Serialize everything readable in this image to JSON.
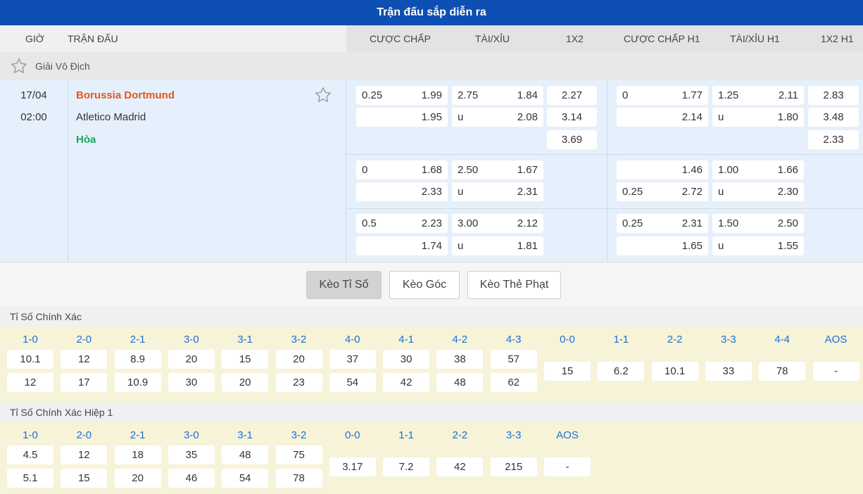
{
  "header": {
    "title": "Trận đấu sắp diễn ra"
  },
  "columns": {
    "time": "GIỜ",
    "match": "TRẬN ĐẤU",
    "handicap": "CƯỢC CHẤP",
    "overunder": "TÀI/XỈU",
    "x12": "1X2",
    "handicap_h1": "CƯỢC CHẤP H1",
    "overunder_h1": "TÀI/XỈU H1",
    "x12_h1": "1X2 H1"
  },
  "league": {
    "name": "Giải Vô Địch",
    "icon": "star-outline-icon"
  },
  "match": {
    "date": "17/04",
    "time": "02:00",
    "home": "Borussia Dortmund",
    "away": "Atletico Madrid",
    "draw": "Hòa",
    "colors": {
      "home": "#e3561f",
      "draw": "#17a85a"
    },
    "x12": [
      "2.27",
      "3.14",
      "3.69"
    ],
    "x12_h1": [
      "2.83",
      "3.48",
      "2.33"
    ],
    "lines": [
      {
        "hdp": {
          "line_top": "0.25",
          "top": "1.99",
          "line_bottom": "",
          "bottom": "1.95"
        },
        "ou": {
          "line": "2.75",
          "top": "1.84",
          "under_label": "u",
          "bottom": "2.08"
        },
        "hdp_h1": {
          "line_top": "0",
          "top": "1.77",
          "line_bottom": "",
          "bottom": "2.14"
        },
        "ou_h1": {
          "line": "1.25",
          "top": "2.11",
          "under_label": "u",
          "bottom": "1.80"
        }
      },
      {
        "hdp": {
          "line_top": "0",
          "top": "1.68",
          "line_bottom": "",
          "bottom": "2.33"
        },
        "ou": {
          "line": "2.50",
          "top": "1.67",
          "under_label": "u",
          "bottom": "2.31"
        },
        "hdp_h1": {
          "line_top": "",
          "top": "1.46",
          "line_bottom": "0.25",
          "bottom": "2.72"
        },
        "ou_h1": {
          "line": "1.00",
          "top": "1.66",
          "under_label": "u",
          "bottom": "2.30"
        }
      },
      {
        "hdp": {
          "line_top": "0.5",
          "top": "2.23",
          "line_bottom": "",
          "bottom": "1.74"
        },
        "ou": {
          "line": "3.00",
          "top": "2.12",
          "under_label": "u",
          "bottom": "1.81"
        },
        "hdp_h1": {
          "line_top": "0.25",
          "top": "2.31",
          "line_bottom": "",
          "bottom": "1.65"
        },
        "ou_h1": {
          "line": "1.50",
          "top": "2.50",
          "under_label": "u",
          "bottom": "1.55"
        }
      }
    ]
  },
  "tabs": [
    {
      "label": "Kèo Tỉ Số",
      "active": true
    },
    {
      "label": "Kèo Góc",
      "active": false
    },
    {
      "label": "Kèo Thẻ Phạt",
      "active": false
    }
  ],
  "correct_score": {
    "title": "Tỉ Số Chính Xác",
    "pairs": [
      {
        "label": "1-0",
        "home": "10.1",
        "away": "12"
      },
      {
        "label": "2-0",
        "home": "12",
        "away": "17"
      },
      {
        "label": "2-1",
        "home": "8.9",
        "away": "10.9"
      },
      {
        "label": "3-0",
        "home": "20",
        "away": "30"
      },
      {
        "label": "3-1",
        "home": "15",
        "away": "20"
      },
      {
        "label": "3-2",
        "home": "20",
        "away": "23"
      },
      {
        "label": "4-0",
        "home": "37",
        "away": "54"
      },
      {
        "label": "4-1",
        "home": "30",
        "away": "42"
      },
      {
        "label": "4-2",
        "home": "38",
        "away": "48"
      },
      {
        "label": "4-3",
        "home": "57",
        "away": "62"
      }
    ],
    "singles": [
      {
        "label": "0-0",
        "value": "15"
      },
      {
        "label": "1-1",
        "value": "6.2"
      },
      {
        "label": "2-2",
        "value": "10.1"
      },
      {
        "label": "3-3",
        "value": "33"
      },
      {
        "label": "4-4",
        "value": "78"
      },
      {
        "label": "AOS",
        "value": "-"
      }
    ]
  },
  "correct_score_h1": {
    "title": "Tỉ Số Chính Xác Hiệp 1",
    "pairs": [
      {
        "label": "1-0",
        "home": "4.5",
        "away": "5.1"
      },
      {
        "label": "2-0",
        "home": "12",
        "away": "15"
      },
      {
        "label": "2-1",
        "home": "18",
        "away": "20"
      },
      {
        "label": "3-0",
        "home": "35",
        "away": "46"
      },
      {
        "label": "3-1",
        "home": "48",
        "away": "54"
      },
      {
        "label": "3-2",
        "home": "75",
        "away": "78"
      }
    ],
    "singles": [
      {
        "label": "0-0",
        "value": "3.17"
      },
      {
        "label": "1-1",
        "value": "7.2"
      },
      {
        "label": "2-2",
        "value": "42"
      },
      {
        "label": "3-3",
        "value": "215"
      },
      {
        "label": "AOS",
        "value": "-"
      }
    ]
  }
}
